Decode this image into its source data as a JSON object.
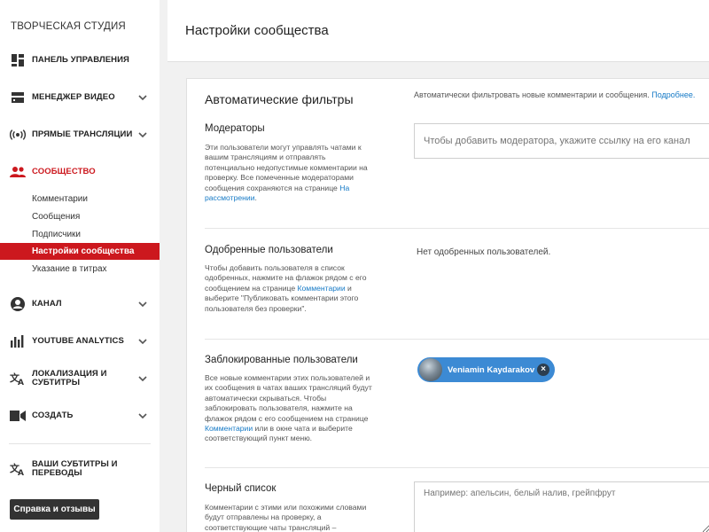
{
  "sidebar": {
    "studio_title": "ТВОРЧЕСКАЯ СТУДИЯ",
    "items": [
      {
        "label": "ПАНЕЛЬ УПРАВЛЕНИЯ",
        "icon": "dashboard-icon"
      },
      {
        "label": "МЕНЕДЖЕР ВИДЕО",
        "icon": "video-manager-icon"
      },
      {
        "label": "ПРЯМЫЕ ТРАНСЛЯЦИИ",
        "icon": "live-icon"
      },
      {
        "label": "СООБЩЕСТВО",
        "icon": "community-icon"
      },
      {
        "label": "КАНАЛ",
        "icon": "channel-icon"
      },
      {
        "label": "YOUTUBE ANALYTICS",
        "icon": "analytics-icon"
      },
      {
        "label_line1": "ЛОКАЛИЗАЦИЯ И",
        "label_line2": "СУБТИТРЫ",
        "icon": "translate-icon"
      },
      {
        "label": "СОЗДАТЬ",
        "icon": "create-icon"
      },
      {
        "label_line1": "ВАШИ СУБТИТРЫ И",
        "label_line2": "ПЕРЕВОДЫ",
        "icon": "subtitles-icon"
      }
    ],
    "community_subitems": [
      "Комментарии",
      "Сообщения",
      "Подписчики",
      "Настройки сообщества",
      "Указание в титрах"
    ],
    "help_button": "Справка и отзывы",
    "accent_color": "#cc181e"
  },
  "header": {
    "title": "Настройки сообщества"
  },
  "card": {
    "title": "Автоматические фильтры",
    "description": "Автоматически фильтровать новые комментарии и сообщения.",
    "description_link": "Подробнее.",
    "sections": {
      "moderators": {
        "title": "Модераторы",
        "desc": "Эти пользователи могут управлять чатами к вашим трансляциям и отправлять потенциально недопустимые комментарии на проверку. Все помеченные модераторами сообщения сохраняются на странице",
        "desc_link": "На рассмотрении",
        "desc_end": ".",
        "input_placeholder": "Чтобы добавить модератора, укажите ссылку на его канал"
      },
      "approved": {
        "title": "Одобренные пользователи",
        "desc_1": "Чтобы добавить пользователя в список одобренных, нажмите на флажок рядом с его сообщением на странице",
        "desc_link": "Комментарии",
        "desc_2": "и выберите \"Публиковать комментарии этого пользователя без проверки\".",
        "empty_text": "Нет одобренных пользователей."
      },
      "blocked": {
        "title": "Заблокированные пользователи",
        "desc_1": "Все новые комментарии этих пользователей и их сообщения в чатах ваших трансляций будут автоматически скрываться. Чтобы заблокировать пользователя, нажмите на флажок рядом с его сообщением на странице",
        "desc_link": "Комментарии",
        "desc_2": "или в окне чата и выберите соответствующий пункт меню.",
        "chip_name": "Veniamin Kaydarakov"
      },
      "blacklist": {
        "title": "Черный список",
        "desc": "Комментарии с этими или похожими словами будут отправлены на проверку, а соответствующие чаты трансляций –",
        "placeholder": "Например: апельсин, белый налив, грейпфрут"
      }
    }
  }
}
